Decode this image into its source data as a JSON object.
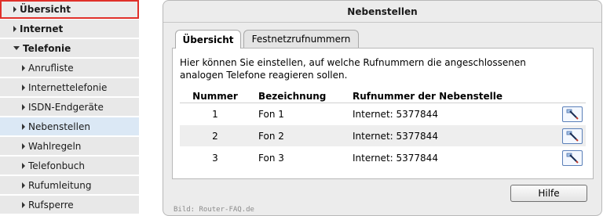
{
  "sidebar": {
    "items": [
      {
        "label": "Übersicht"
      },
      {
        "label": "Internet"
      },
      {
        "label": "Telefonie"
      },
      {
        "label": "Anrufliste"
      },
      {
        "label": "Internettelefonie"
      },
      {
        "label": "ISDN-Endgeräte"
      },
      {
        "label": "Nebenstellen"
      },
      {
        "label": "Wahlregeln"
      },
      {
        "label": "Telefonbuch"
      },
      {
        "label": "Rufumleitung"
      },
      {
        "label": "Rufsperre"
      }
    ]
  },
  "panel": {
    "title": "Nebenstellen",
    "tabs": [
      {
        "label": "Übersicht"
      },
      {
        "label": "Festnetzrufnummern"
      }
    ],
    "intro": "Hier können Sie einstellen, auf welche Rufnummern die angeschlossenen analogen Telefone reagieren sollen.",
    "table": {
      "headers": [
        "Nummer",
        "Bezeichnung",
        "Rufnummer der Nebenstelle"
      ],
      "rows": [
        {
          "nummer": "1",
          "bezeichnung": "Fon 1",
          "rufnummer": "Internet: 5377844"
        },
        {
          "nummer": "2",
          "bezeichnung": "Fon 2",
          "rufnummer": "Internet: 5377844"
        },
        {
          "nummer": "3",
          "bezeichnung": "Fon 3",
          "rufnummer": "Internet: 5377844"
        }
      ]
    },
    "help_label": "Hilfe",
    "credit": "Bild: Router-FAQ.de"
  },
  "colors": {
    "highlight_border": "#e0302a",
    "active_nav": "#dbe8f5",
    "edit_button_border": "#5a7fb8"
  },
  "icons": {
    "edit": "edit-pencil-icon"
  }
}
